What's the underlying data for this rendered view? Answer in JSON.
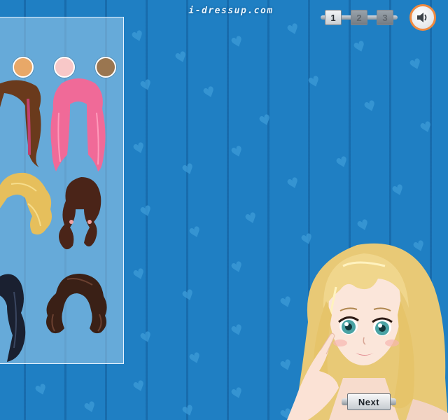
{
  "site": {
    "logo_text": "i-dressup.com"
  },
  "pager": {
    "pages": [
      {
        "label": "1",
        "state": "active"
      },
      {
        "label": "2",
        "state": "inactive"
      },
      {
        "label": "3",
        "state": "inactive"
      }
    ]
  },
  "sound": {
    "icon": "speaker-icon"
  },
  "panel": {
    "swatches": [
      {
        "color": "#e8a868"
      },
      {
        "color": "#f8c8c8"
      },
      {
        "color": "#9a7650"
      }
    ],
    "hairstyles": [
      {
        "color": "#6a3a1c"
      },
      {
        "color": "#f06a98"
      },
      {
        "color": "#e6bf5c"
      },
      {
        "color": "#4a2418"
      },
      {
        "color": "#1a2030"
      },
      {
        "color": "#3a2016"
      }
    ]
  },
  "footer": {
    "next_label": "Next"
  },
  "colors": {
    "background": "#1f7fc3",
    "accent_orange": "#f08a40"
  }
}
